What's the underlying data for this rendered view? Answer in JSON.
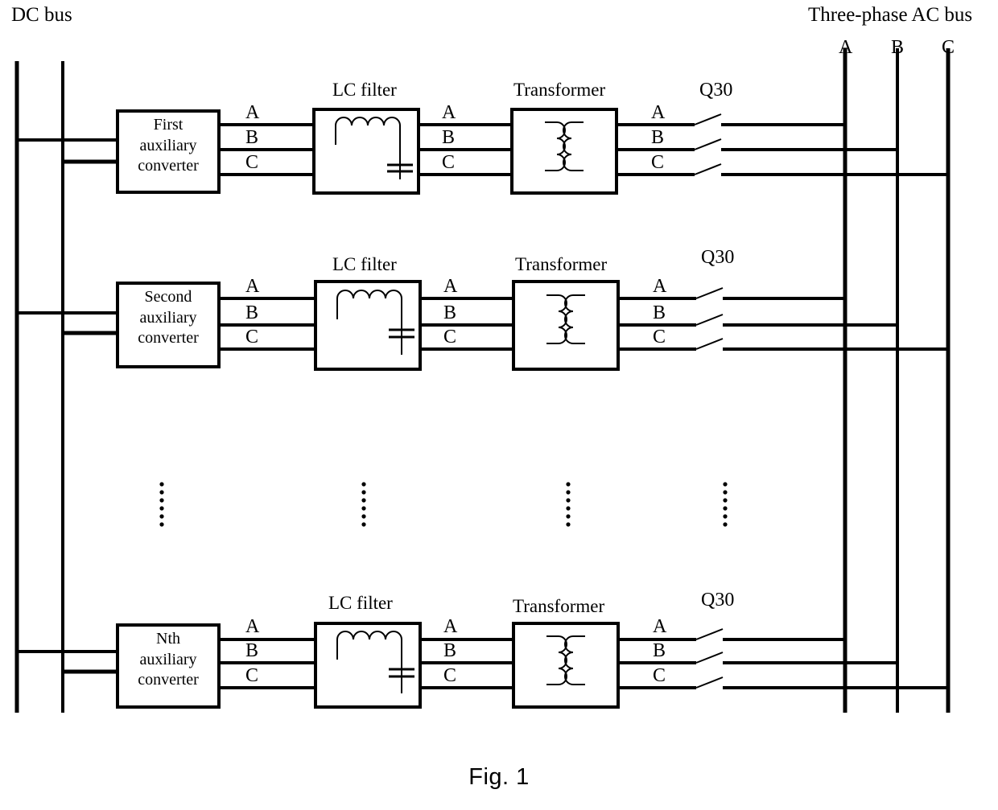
{
  "figure": {
    "caption": "Fig. 1",
    "dc_bus_label": "DC bus",
    "ac_bus_label": "Three-phase AC bus"
  },
  "ac_bus_phases": [
    {
      "label": "A"
    },
    {
      "label": "B"
    },
    {
      "label": "C"
    }
  ],
  "stage_titles": {
    "lc_filter": "LC filter",
    "transformer": "Transformer",
    "switch": "Q30"
  },
  "phase_labels": {
    "a": "A",
    "b": "B",
    "c": "C"
  },
  "rows": [
    {
      "converter_lines": [
        "First",
        "auxiliary",
        "converter"
      ],
      "lc_filter_title": "LC filter",
      "transformer_title": "Transformer",
      "switch_label": "Q30",
      "out_phases": [
        "A",
        "B",
        "C"
      ],
      "mid_phases": [
        "A",
        "B",
        "C"
      ],
      "bus_phases": [
        "A",
        "B",
        "C"
      ]
    },
    {
      "converter_lines": [
        "Second",
        "auxiliary",
        "converter"
      ],
      "lc_filter_title": "LC filter",
      "transformer_title": "Transformer",
      "switch_label": "Q30",
      "out_phases": [
        "A",
        "B",
        "C"
      ],
      "mid_phases": [
        "A",
        "B",
        "C"
      ],
      "bus_phases": [
        "A",
        "B",
        "C"
      ]
    },
    {
      "converter_lines": [
        "Nth",
        "auxiliary",
        "converter"
      ],
      "lc_filter_title": "LC filter",
      "transformer_title": "Transformer",
      "switch_label": "Q30",
      "out_phases": [
        "A",
        "B",
        "C"
      ],
      "mid_phases": [
        "A",
        "B",
        "C"
      ],
      "bus_phases": [
        "A",
        "B",
        "C"
      ]
    }
  ],
  "ellipsis": {
    "dot_count": 6,
    "columns": 4
  },
  "colors": {
    "line": "#000000",
    "background": "#ffffff"
  }
}
